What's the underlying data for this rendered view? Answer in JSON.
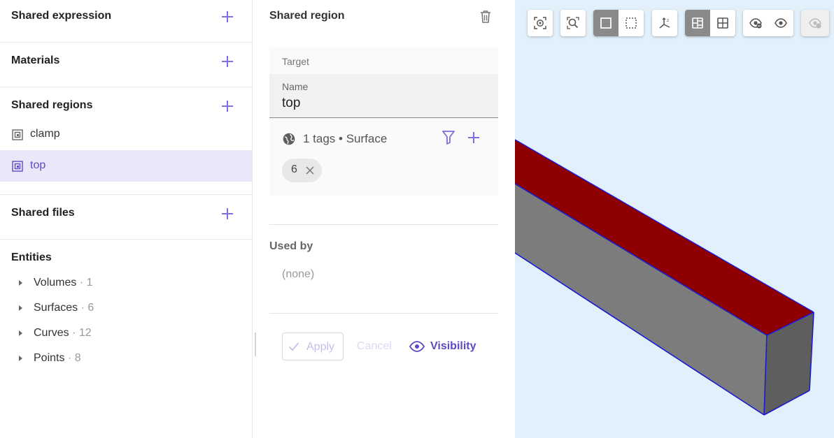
{
  "sidebar": {
    "sections": {
      "shared_expression": {
        "title": "Shared expression"
      },
      "materials": {
        "title": "Materials"
      },
      "shared_regions": {
        "title": "Shared regions",
        "items": [
          {
            "label": "clamp",
            "selected": false
          },
          {
            "label": "top",
            "selected": true
          }
        ]
      },
      "shared_files": {
        "title": "Shared files"
      },
      "entities": {
        "title": "Entities",
        "items": [
          {
            "name": "Volumes",
            "count": " · 1"
          },
          {
            "name": "Surfaces",
            "count": " · 6"
          },
          {
            "name": "Curves",
            "count": " · 12"
          },
          {
            "name": "Points",
            "count": " · 8"
          }
        ]
      }
    }
  },
  "panel": {
    "title": "Shared region",
    "target_label": "Target",
    "name_label": "Name",
    "name_value": "top",
    "tags_summary": "1 tags • Surface",
    "chip": "6",
    "used_by_title": "Used by",
    "used_by_value": "(none)",
    "apply_label": "Apply",
    "cancel_label": "Cancel",
    "visibility_label": "Visibility"
  },
  "viewport": {
    "toolbar_groups": [
      {
        "buttons": [
          "zoom-selection-icon"
        ]
      },
      {
        "buttons": [
          "zoom-fit-icon"
        ]
      },
      {
        "buttons": [
          "select-box-icon",
          "select-dashed-icon"
        ],
        "active": 0
      },
      {
        "buttons": [
          "axes-icon"
        ]
      },
      {
        "buttons": [
          "view-split-icon",
          "view-grid-icon"
        ],
        "active": 0
      },
      {
        "buttons": [
          "hide-icon",
          "show-icon"
        ]
      },
      {
        "buttons": [
          "visibility-disabled-icon"
        ],
        "disabled": true
      }
    ],
    "colors": {
      "background": "#e1f0fb",
      "highlighted_face": "#8e0000",
      "front_face": "#7c7c7c",
      "end_face": "#5e5e5e",
      "edges": "#1a1ad0",
      "accent": "#7d6fe0"
    }
  }
}
